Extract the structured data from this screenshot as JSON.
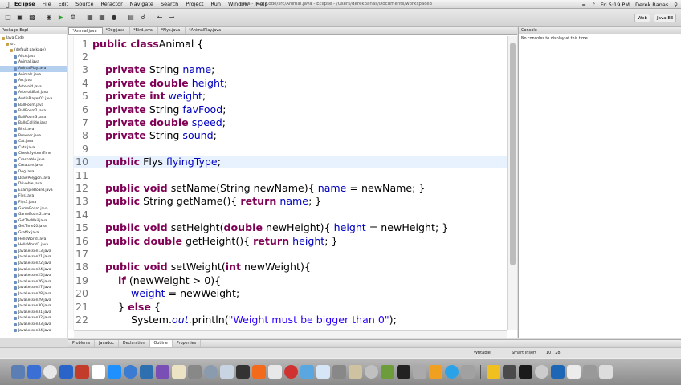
{
  "menubar": {
    "app": "Eclipse",
    "items": [
      "File",
      "Edit",
      "Source",
      "Refactor",
      "Navigate",
      "Search",
      "Project",
      "Run",
      "Window",
      "Help"
    ],
    "window_title": "Java - Java Code/src/Animal.java - Eclipse - /Users/derekbanas/Documents/workspace3",
    "clock": "Fri 5:19 PM",
    "user": "Derek Banas"
  },
  "perspectives": {
    "web": "Web",
    "java": "Java EE"
  },
  "package_explorer": {
    "tab": "Package Expl",
    "items": [
      {
        "label": "Java Code",
        "indent": 0,
        "selected": false
      },
      {
        "label": "src",
        "indent": 1,
        "selected": false
      },
      {
        "label": "(default package)",
        "indent": 2,
        "selected": false
      },
      {
        "label": "Alice.java",
        "indent": 3,
        "selected": false
      },
      {
        "label": "Animal.java",
        "indent": 3,
        "selected": false
      },
      {
        "label": "AnimalPlay.java",
        "indent": 3,
        "selected": true
      },
      {
        "label": "Animals.java",
        "indent": 3,
        "selected": false
      },
      {
        "label": "Arr.java",
        "indent": 3,
        "selected": false
      },
      {
        "label": "Asteroid.java",
        "indent": 3,
        "selected": false
      },
      {
        "label": "AsteroidBall.java",
        "indent": 3,
        "selected": false
      },
      {
        "label": "AudioPlayer02.java",
        "indent": 3,
        "selected": false
      },
      {
        "label": "BallRoom.java",
        "indent": 3,
        "selected": false
      },
      {
        "label": "BallRoom2.java",
        "indent": 3,
        "selected": false
      },
      {
        "label": "BallRoom3.java",
        "indent": 3,
        "selected": false
      },
      {
        "label": "BallsCollide.java",
        "indent": 3,
        "selected": false
      },
      {
        "label": "Bird.java",
        "indent": 3,
        "selected": false
      },
      {
        "label": "Browser.java",
        "indent": 3,
        "selected": false
      },
      {
        "label": "Cat.java",
        "indent": 3,
        "selected": false
      },
      {
        "label": "Cats.java",
        "indent": 3,
        "selected": false
      },
      {
        "label": "CheckSystemTime",
        "indent": 3,
        "selected": false
      },
      {
        "label": "Crashable.java",
        "indent": 3,
        "selected": false
      },
      {
        "label": "Creature.java",
        "indent": 3,
        "selected": false
      },
      {
        "label": "Dog.java",
        "indent": 3,
        "selected": false
      },
      {
        "label": "DrawPolygon.java",
        "indent": 3,
        "selected": false
      },
      {
        "label": "Driveble.java",
        "indent": 3,
        "selected": false
      },
      {
        "label": "ExampleBoard.java",
        "indent": 3,
        "selected": false
      },
      {
        "label": "Flys.java",
        "indent": 3,
        "selected": false
      },
      {
        "label": "Flys1.java",
        "indent": 3,
        "selected": false
      },
      {
        "label": "GameBoard.java",
        "indent": 3,
        "selected": false
      },
      {
        "label": "GameBoard2.java",
        "indent": 3,
        "selected": false
      },
      {
        "label": "GetTheMail.java",
        "indent": 3,
        "selected": false
      },
      {
        "label": "GetTime20.java",
        "indent": 3,
        "selected": false
      },
      {
        "label": "Graffix.java",
        "indent": 3,
        "selected": false
      },
      {
        "label": "HelloWorld.java",
        "indent": 3,
        "selected": false
      },
      {
        "label": "HelloWorld1.java",
        "indent": 3,
        "selected": false
      },
      {
        "label": "JavaLesson13.java",
        "indent": 3,
        "selected": false
      },
      {
        "label": "JavaLesson21.java",
        "indent": 3,
        "selected": false
      },
      {
        "label": "JavaLesson22.java",
        "indent": 3,
        "selected": false
      },
      {
        "label": "JavaLesson24.java",
        "indent": 3,
        "selected": false
      },
      {
        "label": "JavaLesson25.java",
        "indent": 3,
        "selected": false
      },
      {
        "label": "JavaLesson26.java",
        "indent": 3,
        "selected": false
      },
      {
        "label": "JavaLesson27.java",
        "indent": 3,
        "selected": false
      },
      {
        "label": "JavaLesson28.java",
        "indent": 3,
        "selected": false
      },
      {
        "label": "JavaLesson29.java",
        "indent": 3,
        "selected": false
      },
      {
        "label": "JavaLesson30.java",
        "indent": 3,
        "selected": false
      },
      {
        "label": "JavaLesson31.java",
        "indent": 3,
        "selected": false
      },
      {
        "label": "JavaLesson32.java",
        "indent": 3,
        "selected": false
      },
      {
        "label": "JavaLesson33.java",
        "indent": 3,
        "selected": false
      },
      {
        "label": "JavaLesson34.java",
        "indent": 3,
        "selected": false
      }
    ]
  },
  "editor": {
    "tabs": [
      {
        "label": "*Animal.java",
        "active": true
      },
      {
        "label": "*Dog.java",
        "active": false
      },
      {
        "label": "*Bird.java",
        "active": false
      },
      {
        "label": "*Flys.java",
        "active": false
      },
      {
        "label": "*AnimalPlay.java",
        "active": false
      }
    ],
    "current_line": 10,
    "lines": [
      {
        "n": "1",
        "indent": 0,
        "tokens": [
          [
            "kw",
            "public class"
          ],
          [
            "",
            "Animal {"
          ]
        ]
      },
      {
        "n": "2",
        "indent": 0,
        "tokens": []
      },
      {
        "n": "3",
        "indent": 1,
        "tokens": [
          [
            "kw",
            "private"
          ],
          [
            "",
            " String "
          ],
          [
            "fld",
            "name"
          ],
          [
            "",
            ";"
          ]
        ]
      },
      {
        "n": "4",
        "indent": 1,
        "tokens": [
          [
            "kw",
            "private double"
          ],
          [
            "",
            " "
          ],
          [
            "fld",
            "height"
          ],
          [
            "",
            ";"
          ]
        ]
      },
      {
        "n": "5",
        "indent": 1,
        "tokens": [
          [
            "kw",
            "private int"
          ],
          [
            "",
            " "
          ],
          [
            "fld",
            "weight"
          ],
          [
            "",
            ";"
          ]
        ]
      },
      {
        "n": "6",
        "indent": 1,
        "tokens": [
          [
            "kw",
            "private"
          ],
          [
            "",
            " String "
          ],
          [
            "fld",
            "favFood"
          ],
          [
            "",
            ";"
          ]
        ]
      },
      {
        "n": "7",
        "indent": 1,
        "tokens": [
          [
            "kw",
            "private double"
          ],
          [
            "",
            " "
          ],
          [
            "fld",
            "speed"
          ],
          [
            "",
            ";"
          ]
        ]
      },
      {
        "n": "8",
        "indent": 1,
        "tokens": [
          [
            "kw",
            "private"
          ],
          [
            "",
            " String "
          ],
          [
            "fld",
            "sound"
          ],
          [
            "",
            ";"
          ]
        ]
      },
      {
        "n": "9",
        "indent": 0,
        "tokens": []
      },
      {
        "n": "10",
        "indent": 1,
        "tokens": [
          [
            "kw",
            "public"
          ],
          [
            "",
            " Flys "
          ],
          [
            "fld",
            "flyingType"
          ],
          [
            "",
            ";"
          ]
        ]
      },
      {
        "n": "11",
        "indent": 0,
        "tokens": []
      },
      {
        "n": "12",
        "indent": 1,
        "tokens": [
          [
            "kw",
            "public void"
          ],
          [
            "",
            " setName(String newName){ "
          ],
          [
            "fld",
            "name"
          ],
          [
            "",
            " = newName; }"
          ]
        ]
      },
      {
        "n": "13",
        "indent": 1,
        "tokens": [
          [
            "kw",
            "public"
          ],
          [
            "",
            " String getName(){ "
          ],
          [
            "kw",
            "return"
          ],
          [
            "",
            " "
          ],
          [
            "fld",
            "name"
          ],
          [
            "",
            "; }"
          ]
        ]
      },
      {
        "n": "14",
        "indent": 0,
        "tokens": []
      },
      {
        "n": "15",
        "indent": 1,
        "tokens": [
          [
            "kw",
            "public void"
          ],
          [
            "",
            " setHeight("
          ],
          [
            "kw",
            "double"
          ],
          [
            "",
            " newHeight){ "
          ],
          [
            "fld",
            "height"
          ],
          [
            "",
            " = newHeight; }"
          ]
        ]
      },
      {
        "n": "16",
        "indent": 1,
        "tokens": [
          [
            "kw",
            "public double"
          ],
          [
            "",
            " getHeight(){ "
          ],
          [
            "kw",
            "return"
          ],
          [
            "",
            " "
          ],
          [
            "fld",
            "height"
          ],
          [
            "",
            "; }"
          ]
        ]
      },
      {
        "n": "17",
        "indent": 0,
        "tokens": []
      },
      {
        "n": "18",
        "indent": 1,
        "tokens": [
          [
            "kw",
            "public void"
          ],
          [
            "",
            " setWeight("
          ],
          [
            "kw",
            "int"
          ],
          [
            "",
            " newWeight){"
          ]
        ]
      },
      {
        "n": "19",
        "indent": 2,
        "tokens": [
          [
            "kw",
            "if"
          ],
          [
            "",
            " (newWeight > 0){"
          ]
        ]
      },
      {
        "n": "20",
        "indent": 3,
        "tokens": [
          [
            "fld",
            "weight"
          ],
          [
            "",
            " = newWeight;"
          ]
        ]
      },
      {
        "n": "21",
        "indent": 2,
        "tokens": [
          [
            "",
            "} "
          ],
          [
            "kw",
            "else"
          ],
          [
            "",
            " {"
          ]
        ]
      },
      {
        "n": "22",
        "indent": 3,
        "tokens": [
          [
            "",
            "System."
          ],
          [
            "fld it",
            "out"
          ],
          [
            "",
            ".println("
          ],
          [
            "str",
            "\"Weight must be bigger than 0\""
          ],
          [
            "",
            ");"
          ]
        ]
      }
    ]
  },
  "console": {
    "tab": "Console",
    "message": "No consoles to display at this time."
  },
  "bottom_tabs": [
    {
      "label": "Problems",
      "active": false
    },
    {
      "label": "Javadoc",
      "active": false
    },
    {
      "label": "Declaration",
      "active": false
    },
    {
      "label": "Outline",
      "active": true
    },
    {
      "label": "Properties",
      "active": false
    }
  ],
  "statusbar": {
    "writable": "Writable",
    "insert": "Smart Insert",
    "position": "10 : 28"
  },
  "dock_colors": [
    "#5b7fb5",
    "#3a6fd6",
    "#e8e8e8",
    "#2b64c8",
    "#c23b2b",
    "#ffffff",
    "#1e90ff",
    "#3b7bd1",
    "#2e6fb0",
    "#7a4fb5",
    "#ece3c4",
    "#888888",
    "#8a9bb0",
    "#c8d4e2",
    "#333333",
    "#f26b1d",
    "#e8e8e8",
    "#d03232",
    "#59a6e0",
    "#d6e6f6",
    "#888888",
    "#cfc2a0",
    "#c0c0c0",
    "#6d9c3a",
    "#222222",
    "#aaaaaa",
    "#f0a020",
    "#2aa2e8",
    "#a1a1a1",
    "#f0c020",
    "#4a4a4a",
    "#1a1a1a",
    "#cccccc",
    "#1d66b6",
    "#ececec",
    "#999999",
    "#dddddd"
  ]
}
